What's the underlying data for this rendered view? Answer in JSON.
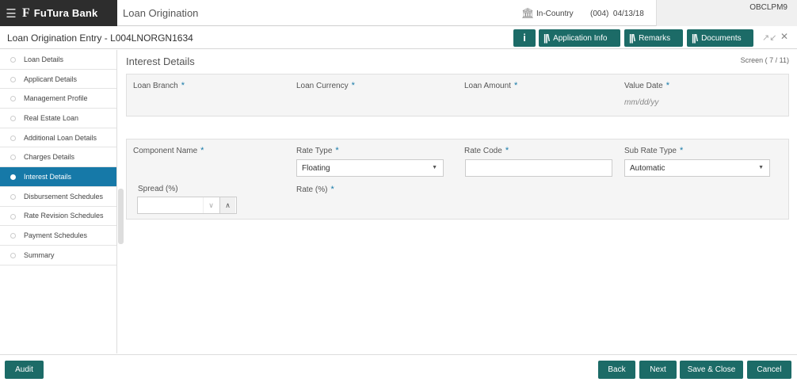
{
  "topbar": {
    "brand_logo": "F",
    "brand_name": "FuTura Bank",
    "app_title": "Loan Origination",
    "country": "In-Country",
    "branch_code": "(004)",
    "date": "04/13/18",
    "user": "OBCLPM9"
  },
  "header": {
    "page_title": "Loan Origination Entry - L004LNORGN1634",
    "info_label": "i",
    "buttons": [
      "Application Info",
      "Remarks",
      "Documents"
    ]
  },
  "sidebar": {
    "items": [
      {
        "label": "Loan Details"
      },
      {
        "label": "Applicant Details"
      },
      {
        "label": "Management Profile"
      },
      {
        "label": "Real Estate Loan"
      },
      {
        "label": "Additional Loan Details"
      },
      {
        "label": "Charges Details"
      },
      {
        "label": "Interest Details",
        "active": true
      },
      {
        "label": "Disbursement Schedules"
      },
      {
        "label": "Rate Revision Schedules"
      },
      {
        "label": "Payment Schedules"
      },
      {
        "label": "Summary"
      }
    ]
  },
  "main": {
    "section_title": "Interest Details",
    "screen_indicator": "Screen ( 7 / 11)",
    "panel1": {
      "loan_branch_label": "Loan Branch",
      "loan_currency_label": "Loan Currency",
      "loan_amount_label": "Loan Amount",
      "value_date_label": "Value Date",
      "value_date_placeholder": "mm/dd/yy"
    },
    "panel2": {
      "component_name_label": "Component Name",
      "rate_type_label": "Rate Type",
      "rate_type_value": "Floating",
      "rate_code_label": "Rate Code",
      "sub_rate_type_label": "Sub Rate Type",
      "sub_rate_type_value": "Automatic",
      "spread_label": "Spread (%)",
      "rate_label": "Rate (%)"
    }
  },
  "footer": {
    "audit": "Audit",
    "back": "Back",
    "next": "Next",
    "save_close": "Save & Close",
    "cancel": "Cancel"
  },
  "colors": {
    "accent": "#1c6b67",
    "active_nav": "#1679a8",
    "brand_bar": "#2d2d2d"
  }
}
